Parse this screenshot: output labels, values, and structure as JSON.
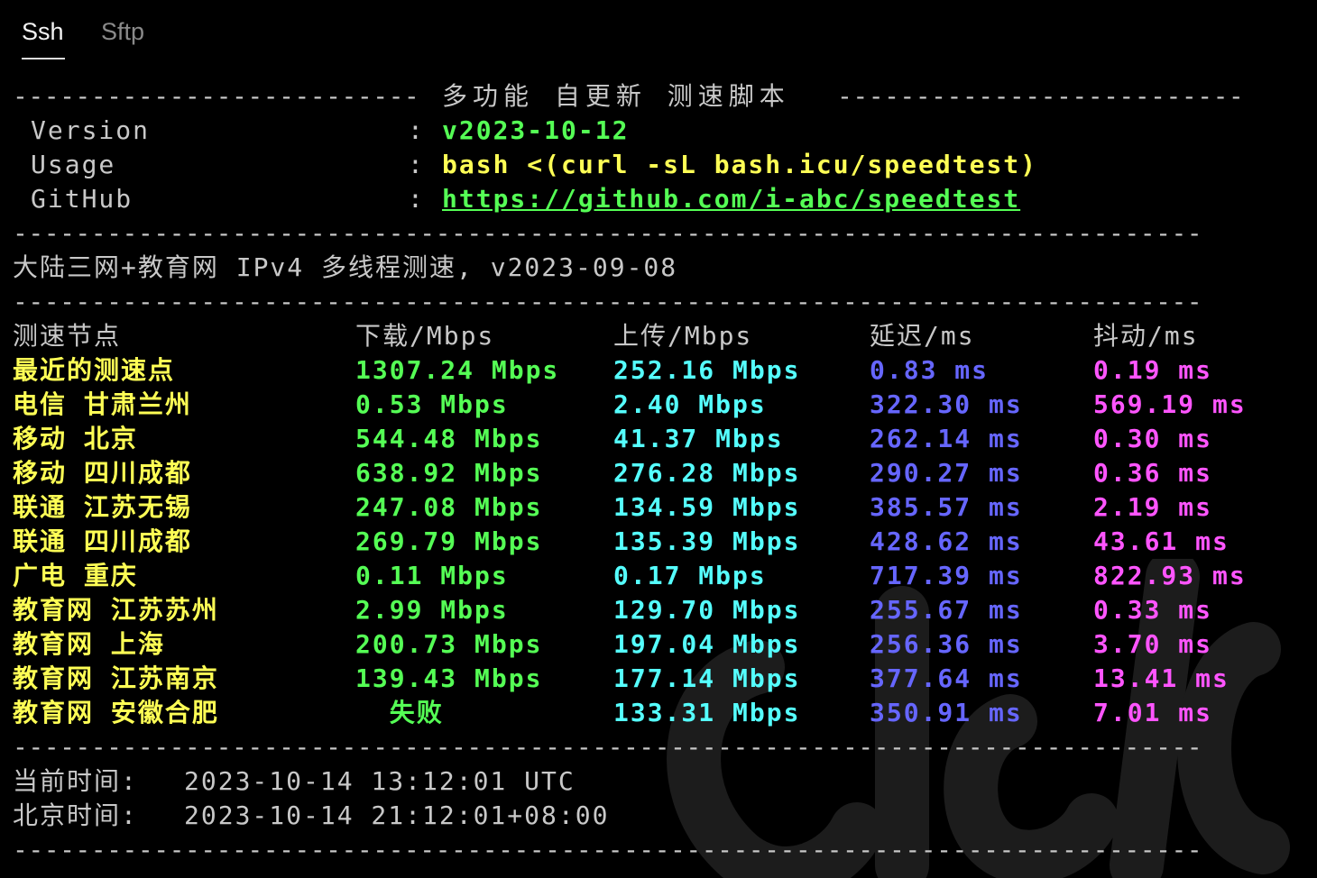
{
  "tabs": {
    "ssh": "Ssh",
    "sftp": "Sftp"
  },
  "terminal": {
    "separator": "----------------------------------------------------------------------------",
    "header_title": "多功能 自更新 测速脚本",
    "info": [
      {
        "key": "Version",
        "colon": ":",
        "value": "v2023-10-12"
      },
      {
        "key": "Usage",
        "colon": ":",
        "value": "bash <(curl -sL bash.icu/speedtest)"
      },
      {
        "key": "GitHub",
        "colon": ":",
        "value": "https://github.com/i-abc/speedtest"
      }
    ],
    "subtitle": "大陆三网+教育网 IPv4 多线程测速, v2023-09-08",
    "columns": {
      "node": "测速节点",
      "download": "下载/Mbps",
      "upload": "上传/Mbps",
      "latency": "延迟/ms",
      "jitter": "抖动/ms"
    },
    "rows": [
      {
        "node": "最近的测速点",
        "download": "1307.24 Mbps",
        "upload": "252.16 Mbps",
        "latency": "0.83 ms",
        "jitter": "0.19 ms"
      },
      {
        "node": "电信 甘肃兰州",
        "download": "0.53 Mbps",
        "upload": "2.40 Mbps",
        "latency": "322.30 ms",
        "jitter": "569.19 ms"
      },
      {
        "node": "移动 北京",
        "download": "544.48 Mbps",
        "upload": "41.37 Mbps",
        "latency": "262.14 ms",
        "jitter": "0.30 ms"
      },
      {
        "node": "移动 四川成都",
        "download": "638.92 Mbps",
        "upload": "276.28 Mbps",
        "latency": "290.27 ms",
        "jitter": "0.36 ms"
      },
      {
        "node": "联通 江苏无锡",
        "download": "247.08 Mbps",
        "upload": "134.59 Mbps",
        "latency": "385.57 ms",
        "jitter": "2.19 ms"
      },
      {
        "node": "联通 四川成都",
        "download": "269.79 Mbps",
        "upload": "135.39 Mbps",
        "latency": "428.62 ms",
        "jitter": "43.61 ms"
      },
      {
        "node": "广电 重庆",
        "download": "0.11 Mbps",
        "upload": "0.17 Mbps",
        "latency": "717.39 ms",
        "jitter": "822.93 ms"
      },
      {
        "node": "教育网 江苏苏州",
        "download": "2.99 Mbps",
        "upload": "129.70 Mbps",
        "latency": "255.67 ms",
        "jitter": "0.33 ms"
      },
      {
        "node": "教育网 上海",
        "download": "200.73 Mbps",
        "upload": "197.04 Mbps",
        "latency": "256.36 ms",
        "jitter": "3.70 ms"
      },
      {
        "node": "教育网 江苏南京",
        "download": "139.43 Mbps",
        "upload": "177.14 Mbps",
        "latency": "377.64 ms",
        "jitter": "13.41 ms"
      },
      {
        "node": "教育网 安徽合肥",
        "download": "  失败",
        "upload": "133.31 Mbps",
        "latency": "350.91 ms",
        "jitter": "7.01 ms"
      }
    ],
    "current_time_label": "当前时间:",
    "current_time_value": "2023-10-14 13:12:01 UTC",
    "beijing_time_label": "北京时间:",
    "beijing_time_value": "2023-10-14 21:12:01+08:00"
  },
  "colors": {
    "background": "#000000",
    "text": "#c8c8c8",
    "node": "#ffff55",
    "download": "#55ff55",
    "upload": "#55ffff",
    "latency": "#6666ff",
    "jitter": "#ff55ff"
  }
}
